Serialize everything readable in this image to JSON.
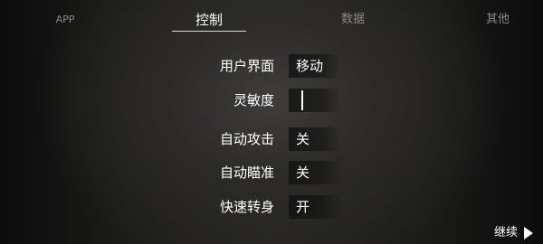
{
  "tabs": [
    {
      "label": "APP"
    },
    {
      "label": "控制",
      "active": true
    },
    {
      "label": "数据"
    },
    {
      "label": "其他"
    }
  ],
  "settings": [
    {
      "label": "用户界面",
      "value": "移动"
    },
    {
      "label": "灵敏度",
      "slider_level": 0.1
    },
    {
      "label": "自动攻击",
      "value": "关"
    },
    {
      "label": "自动瞄准",
      "value": "关"
    },
    {
      "label": "快速转身",
      "value": "开"
    }
  ],
  "continue_button": {
    "label": "继续",
    "icon": "play-triangle-icon"
  },
  "colors": {
    "active_text": "#ffffff",
    "inactive_tab_text": "#8a8986",
    "underline": "#d9d9d9"
  }
}
